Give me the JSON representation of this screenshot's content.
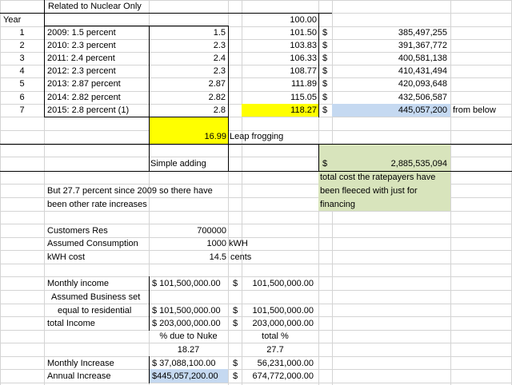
{
  "sheet": {
    "header_note": "Related to Nuclear Only",
    "year_label": "Year",
    "base_index": "100.00",
    "rows": [
      {
        "num": "1",
        "label": "2009: 1.5 percent",
        "rate": "1.5",
        "index": "101.50",
        "cur": "$",
        "amount": "385,497,255"
      },
      {
        "num": "2",
        "label": "2010: 2.3 percent",
        "rate": "2.3",
        "index": "103.83",
        "cur": "$",
        "amount": "391,367,772"
      },
      {
        "num": "3",
        "label": "2011: 2.4 percent",
        "rate": "2.4",
        "index": "106.33",
        "cur": "$",
        "amount": "400,581,138"
      },
      {
        "num": "4",
        "label": "2012: 2.3 percent",
        "rate": "2.3",
        "index": "108.77",
        "cur": "$",
        "amount": "410,431,494"
      },
      {
        "num": "5",
        "label": "2013: 2.87 percent",
        "rate": "2.87",
        "index": "111.89",
        "cur": "$",
        "amount": "420,093,648"
      },
      {
        "num": "6",
        "label": "2014: 2.82 percent",
        "rate": "2.82",
        "index": "115.05",
        "cur": "$",
        "amount": "432,506,587"
      },
      {
        "num": "7",
        "label": "2015: 2.8 percent (1)",
        "rate": "2.8",
        "index": "118.27",
        "cur": "$",
        "amount": "445,057,200"
      }
    ],
    "from_below": "from below",
    "leap_value": "16.99",
    "leap_label": "Leap frogging",
    "simple_adding": "Simple adding",
    "total_cur": "$",
    "total_value": "2,885,535,094",
    "total_note": [
      "total cost the ratepayers have",
      "been fleeced with just for",
      "financing"
    ],
    "since_note": [
      "But 27.7 percent since 2009 so there have",
      "been other rate increases"
    ],
    "customers_label": "Customers Res",
    "customers_value": "700000",
    "consumption_label": "Assumed Consumption",
    "consumption_value": "1000",
    "consumption_unit": "kWH",
    "kwh_cost_label": "kWH cost",
    "kwh_cost_value": "14.5",
    "kwh_cost_unit": "cents",
    "monthly_income_label": "Monthly income",
    "monthly_income_1": "$ 101,500,000.00",
    "monthly_income_cur": "$",
    "monthly_income_2": "101,500,000.00",
    "business_label_1": "Assumed Business set",
    "business_label_2": "equal to residential",
    "business_1": "$ 101,500,000.00",
    "business_cur": "$",
    "business_2": "101,500,000.00",
    "total_income_label": "total Income",
    "total_income_1": "$ 203,000,000.00",
    "total_income_cur": "$",
    "total_income_2": "203,000,000.00",
    "pct_nuke_label": "% due to Nuke",
    "total_pct_label": "total %",
    "pct_nuke_value": "18.27",
    "total_pct_value": "27.7",
    "monthly_increase_label": "Monthly Increase",
    "monthly_increase_1": "$ 37,088,100.00",
    "monthly_increase_cur": "$",
    "monthly_increase_2": "56,231,000.00",
    "annual_increase_label": "Annual Increase",
    "annual_increase_1": "$445,057,200.00",
    "annual_increase_cur": "$",
    "annual_increase_2": "674,772,000.00"
  }
}
